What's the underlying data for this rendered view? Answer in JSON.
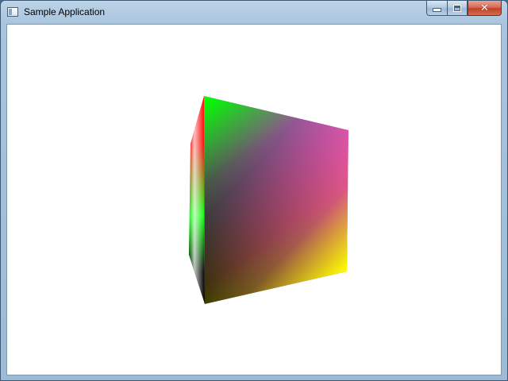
{
  "window": {
    "title": "Sample Application",
    "icon": "application-icon"
  },
  "caption_buttons": {
    "minimize": "minimize-icon",
    "maximize": "maximize-icon",
    "close_symbol": "✕"
  },
  "scene": {
    "object": "rotating-color-cube",
    "colors": {
      "black": "#000000",
      "green": "#00ff00",
      "magenta": "#ff00ff",
      "yellow": "#ffff00",
      "red": "#ff0000",
      "white": "#ffffff"
    }
  }
}
